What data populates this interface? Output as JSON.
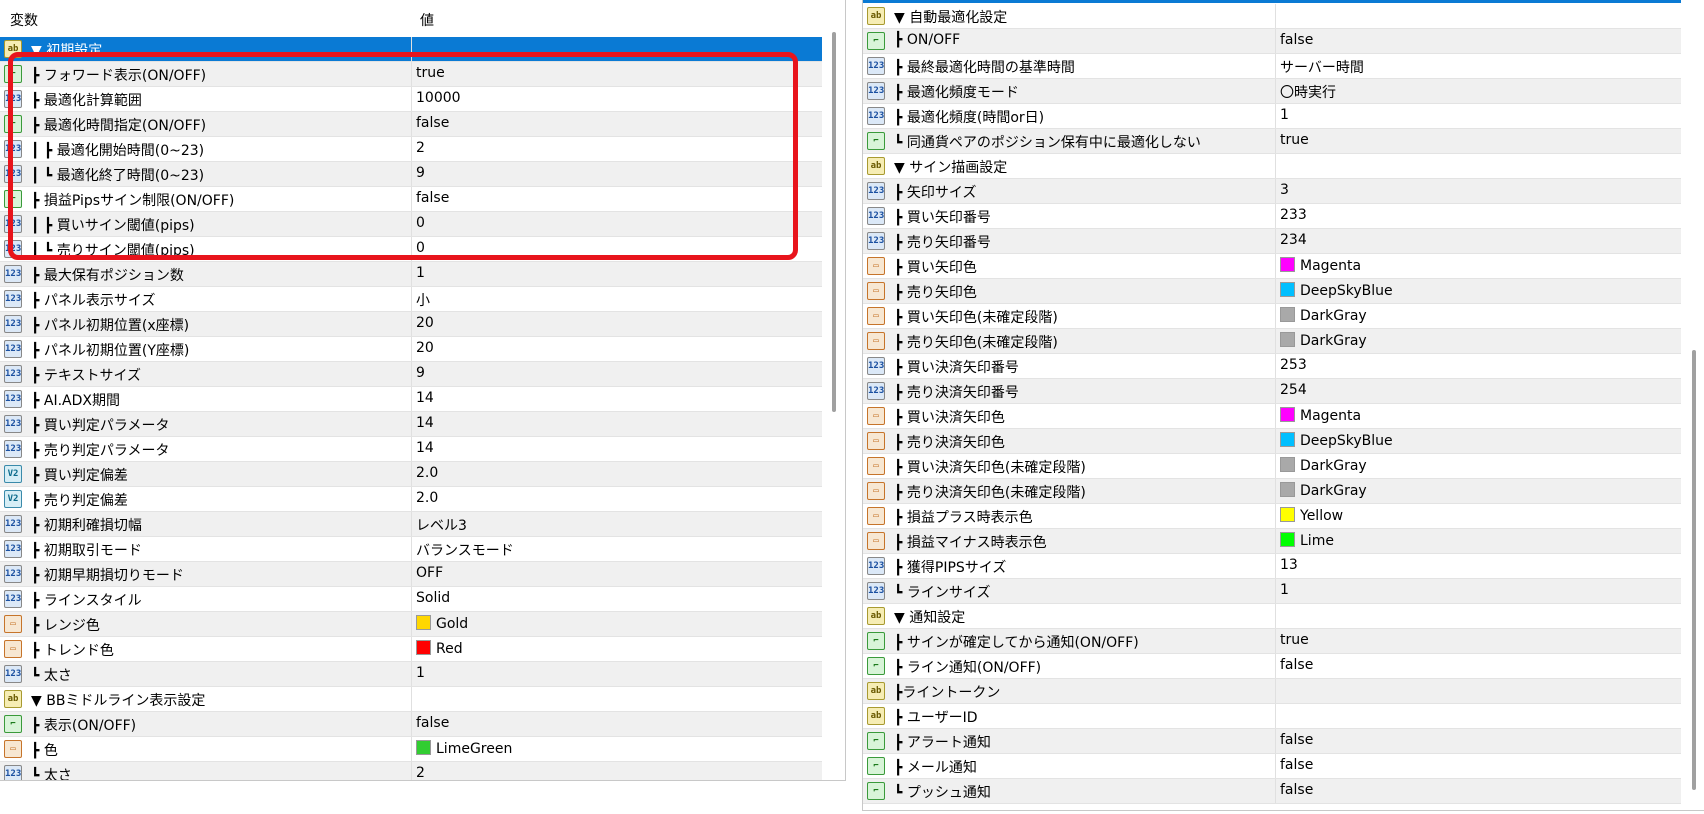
{
  "left": {
    "header": {
      "variable": "変数",
      "value": "値"
    },
    "rows": [
      {
        "icon": "str",
        "label": "▼ 初期設定",
        "value": "",
        "selected": true
      },
      {
        "icon": "bool",
        "label": "┣ フォワード表示(ON/OFF)",
        "value": "true"
      },
      {
        "icon": "int",
        "label": "┣ 最適化計算範囲",
        "value": "10000"
      },
      {
        "icon": "bool",
        "label": "┣ 最適化時間指定(ON/OFF)",
        "value": "false"
      },
      {
        "icon": "int",
        "label": "┃ ┣ 最適化開始時間(0~23)",
        "value": "2"
      },
      {
        "icon": "int",
        "label": "┃ ┗ 最適化終了時間(0~23)",
        "value": "9"
      },
      {
        "icon": "bool",
        "label": "┣ 損益Pipsサイン制限(ON/OFF)",
        "value": "false"
      },
      {
        "icon": "int",
        "label": "┃ ┣ 買いサイン閾値(pips)",
        "value": "0"
      },
      {
        "icon": "int",
        "label": "┃ ┗ 売りサイン閾値(pips)",
        "value": "0"
      },
      {
        "icon": "int",
        "label": "┣ 最大保有ポジション数",
        "value": "1"
      },
      {
        "icon": "int",
        "label": "┣ パネル表示サイズ",
        "value": "小"
      },
      {
        "icon": "int",
        "label": "┣ パネル初期位置(x座標)",
        "value": "20"
      },
      {
        "icon": "int",
        "label": "┣ パネル初期位置(Y座標)",
        "value": "20"
      },
      {
        "icon": "int",
        "label": "┣ テキストサイズ",
        "value": "9"
      },
      {
        "icon": "int",
        "label": "┣ AI.ADX期間",
        "value": "14"
      },
      {
        "icon": "int",
        "label": "┣ 買い判定パラメータ",
        "value": "14"
      },
      {
        "icon": "int",
        "label": "┣ 売り判定パラメータ",
        "value": "14"
      },
      {
        "icon": "dbl",
        "label": "┣ 買い判定偏差",
        "value": "2.0"
      },
      {
        "icon": "dbl",
        "label": "┣ 売り判定偏差",
        "value": "2.0"
      },
      {
        "icon": "int",
        "label": "┣ 初期利確損切幅",
        "value": "レベル3"
      },
      {
        "icon": "int",
        "label": "┣ 初期取引モード",
        "value": "バランスモード"
      },
      {
        "icon": "int",
        "label": "┣ 初期早期損切りモード",
        "value": "OFF"
      },
      {
        "icon": "int",
        "label": "┣ ラインスタイル",
        "value": "Solid"
      },
      {
        "icon": "color",
        "label": "┣ レンジ色",
        "value": "Gold",
        "swatch": "#FFD700"
      },
      {
        "icon": "color",
        "label": "┣ トレンド色",
        "value": "Red",
        "swatch": "#FF0000"
      },
      {
        "icon": "int",
        "label": "┗ 太さ",
        "value": "1"
      },
      {
        "icon": "str",
        "label": "▼ BBミドルライン表示設定",
        "value": ""
      },
      {
        "icon": "bool",
        "label": "┣ 表示(ON/OFF)",
        "value": "false"
      },
      {
        "icon": "color",
        "label": "┣ 色",
        "value": "LimeGreen",
        "swatch": "#32CD32"
      },
      {
        "icon": "int",
        "label": "┗ 太さ",
        "value": "2"
      }
    ]
  },
  "right": {
    "rows": [
      {
        "icon": "str",
        "label": "▼ 自動最適化設定",
        "value": ""
      },
      {
        "icon": "bool",
        "label": "┣ ON/OFF",
        "value": "false"
      },
      {
        "icon": "int",
        "label": "┣ 最終最適化時間の基準時間",
        "value": "サーバー時間"
      },
      {
        "icon": "int",
        "label": "┣ 最適化頻度モード",
        "value": "〇時実行"
      },
      {
        "icon": "int",
        "label": "┣ 最適化頻度(時間or日)",
        "value": "1"
      },
      {
        "icon": "bool",
        "label": "┗ 同通貨ペアのポジション保有中に最適化しない",
        "value": "true"
      },
      {
        "icon": "str",
        "label": "▼ サイン描画設定",
        "value": ""
      },
      {
        "icon": "int",
        "label": "┣ 矢印サイズ",
        "value": "3"
      },
      {
        "icon": "int",
        "label": "┣ 買い矢印番号",
        "value": "233"
      },
      {
        "icon": "int",
        "label": "┣ 売り矢印番号",
        "value": "234"
      },
      {
        "icon": "color",
        "label": "┣ 買い矢印色",
        "value": "Magenta",
        "swatch": "#FF00FF"
      },
      {
        "icon": "color",
        "label": "┣ 売り矢印色",
        "value": "DeepSkyBlue",
        "swatch": "#00BFFF"
      },
      {
        "icon": "color",
        "label": "┣ 買い矢印色(未確定段階)",
        "value": "DarkGray",
        "swatch": "#A9A9A9"
      },
      {
        "icon": "color",
        "label": "┣ 売り矢印色(未確定段階)",
        "value": "DarkGray",
        "swatch": "#A9A9A9"
      },
      {
        "icon": "int",
        "label": "┣ 買い決済矢印番号",
        "value": "253"
      },
      {
        "icon": "int",
        "label": "┣ 売り決済矢印番号",
        "value": "254"
      },
      {
        "icon": "color",
        "label": "┣ 買い決済矢印色",
        "value": "Magenta",
        "swatch": "#FF00FF"
      },
      {
        "icon": "color",
        "label": "┣ 売り決済矢印色",
        "value": "DeepSkyBlue",
        "swatch": "#00BFFF"
      },
      {
        "icon": "color",
        "label": "┣ 買い決済矢印色(未確定段階)",
        "value": "DarkGray",
        "swatch": "#A9A9A9"
      },
      {
        "icon": "color",
        "label": "┣ 売り決済矢印色(未確定段階)",
        "value": "DarkGray",
        "swatch": "#A9A9A9"
      },
      {
        "icon": "color",
        "label": "┣ 損益プラス時表示色",
        "value": "Yellow",
        "swatch": "#FFFF00"
      },
      {
        "icon": "color",
        "label": "┣ 損益マイナス時表示色",
        "value": "Lime",
        "swatch": "#00FF00"
      },
      {
        "icon": "int",
        "label": "┣ 獲得PIPSサイズ",
        "value": "13"
      },
      {
        "icon": "int",
        "label": "┗ ラインサイズ",
        "value": "1"
      },
      {
        "icon": "str",
        "label": "▼ 通知設定",
        "value": ""
      },
      {
        "icon": "bool",
        "label": "┣ サインが確定してから通知(ON/OFF)",
        "value": "true"
      },
      {
        "icon": "bool",
        "label": "┣ ライン通知(ON/OFF)",
        "value": "false"
      },
      {
        "icon": "str",
        "label": "┣ライントークン",
        "value": ""
      },
      {
        "icon": "str",
        "label": "┣ ユーザーID",
        "value": ""
      },
      {
        "icon": "bool",
        "label": "┣ アラート通知",
        "value": "false"
      },
      {
        "icon": "bool",
        "label": "┣ メール通知",
        "value": "false"
      },
      {
        "icon": "bool",
        "label": "┗ プッシュ通知",
        "value": "false"
      }
    ]
  },
  "icon_glyphs": {
    "int": "123",
    "bool": "⌐",
    "str": "ab",
    "color": "▭",
    "dbl": "V2"
  },
  "colors": {
    "selection": "#0a7ad4",
    "highlight_box": "#e8141c"
  }
}
